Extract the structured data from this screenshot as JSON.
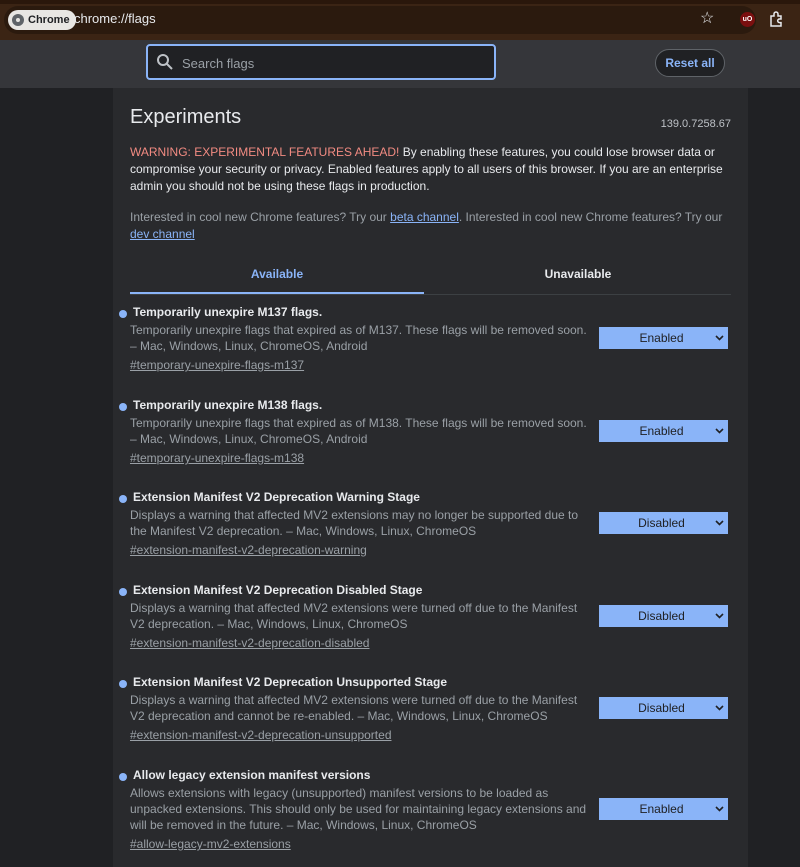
{
  "browser": {
    "chip_label": "Chrome",
    "url": "chrome://flags",
    "ext_badge": "uO"
  },
  "header": {
    "search_placeholder": "Search flags",
    "reset_label": "Reset all"
  },
  "page": {
    "title": "Experiments",
    "version": "139.0.7258.67",
    "warning_title": "WARNING: EXPERIMENTAL FEATURES AHEAD!",
    "warning_body": " By enabling these features, you could lose browser data or compromise your security or privacy. Enabled features apply to all users of this browser. If you are an enterprise admin you should not be using these flags in production.",
    "interest_prefix": "Interested in cool new Chrome features? Try our ",
    "beta_link": "beta channel",
    "interest_mid": ". Interested in cool new Chrome features? Try our ",
    "dev_link": "dev channel"
  },
  "tabs": {
    "available": "Available",
    "unavailable": "Unavailable"
  },
  "flags": [
    {
      "name": "Temporarily unexpire M137 flags.",
      "description": "Temporarily unexpire flags that expired as of M137. These flags will be removed soon. – Mac, Windows, Linux, ChromeOS, Android",
      "hash": "#temporary-unexpire-flags-m137",
      "value": "Enabled"
    },
    {
      "name": "Temporarily unexpire M138 flags.",
      "description": "Temporarily unexpire flags that expired as of M138. These flags will be removed soon. – Mac, Windows, Linux, ChromeOS, Android",
      "hash": "#temporary-unexpire-flags-m138",
      "value": "Enabled"
    },
    {
      "name": "Extension Manifest V2 Deprecation Warning Stage",
      "description": "Displays a warning that affected MV2 extensions may no longer be supported due to the Manifest V2 deprecation. – Mac, Windows, Linux, ChromeOS",
      "hash": "#extension-manifest-v2-deprecation-warning",
      "value": "Disabled"
    },
    {
      "name": "Extension Manifest V2 Deprecation Disabled Stage",
      "description": "Displays a warning that affected MV2 extensions were turned off due to the Manifest V2 deprecation. – Mac, Windows, Linux, ChromeOS",
      "hash": "#extension-manifest-v2-deprecation-disabled",
      "value": "Disabled"
    },
    {
      "name": "Extension Manifest V2 Deprecation Unsupported Stage",
      "description": "Displays a warning that affected MV2 extensions were turned off due to the Manifest V2 deprecation and cannot be re-enabled. – Mac, Windows, Linux, ChromeOS",
      "hash": "#extension-manifest-v2-deprecation-unsupported",
      "value": "Disabled"
    },
    {
      "name": "Allow legacy extension manifest versions",
      "description": "Allows extensions with legacy (unsupported) manifest versions to be loaded as unpacked extensions. This should only be used for maintaining legacy extensions and will be removed in the future. – Mac, Windows, Linux, ChromeOS",
      "hash": "#allow-legacy-mv2-extensions",
      "value": "Enabled"
    }
  ]
}
